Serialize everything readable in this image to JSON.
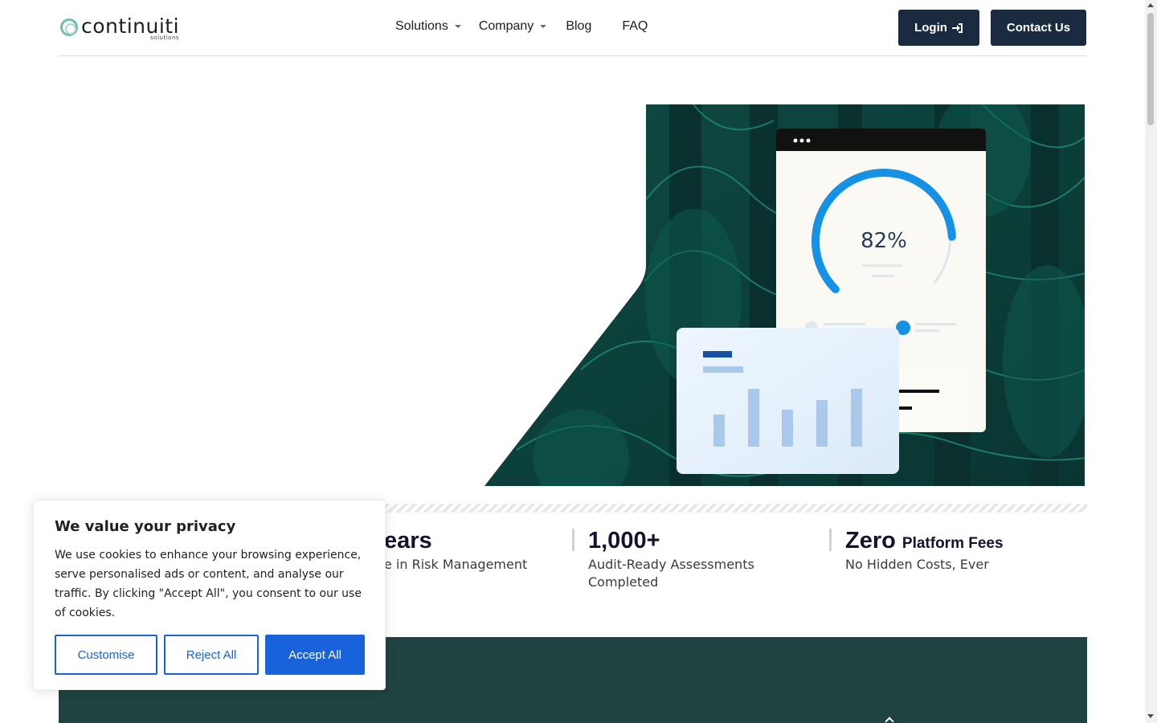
{
  "header": {
    "logo": {
      "word": "continuiti",
      "sub": "solutions"
    },
    "nav": [
      {
        "label": "Solutions",
        "dropdown": true
      },
      {
        "label": "Company",
        "dropdown": true
      },
      {
        "label": "Blog",
        "dropdown": false
      },
      {
        "label": "FAQ",
        "dropdown": false
      }
    ],
    "login_label": "Login",
    "contact_label": "Contact Us"
  },
  "hero": {
    "gauge_value": "82%",
    "gauge_fraction": 0.82
  },
  "stats": [
    {
      "big": "ears",
      "desc": "e in Risk Management"
    },
    {
      "big": "1,000+",
      "desc_line1": "Audit-Ready Assessments",
      "desc_line2": "Completed"
    },
    {
      "big": "Zero",
      "big_suffix": "Platform Fees",
      "desc": "No Hidden Costs, Ever"
    }
  ],
  "cookie": {
    "title": "We value your privacy",
    "text": "We use cookies to enhance your browsing experience, serve personalised ads or content, and analyse our traffic. By clicking \"Accept All\", you consent to our use of cookies.",
    "customise_label": "Customise",
    "reject_label": "Reject All",
    "accept_label": "Accept All"
  },
  "colors": {
    "brand_dark": "#1b2b3f",
    "teal_section": "#1f4341",
    "accent_blue": "#1863dc",
    "gauge_blue": "#1591e6"
  }
}
